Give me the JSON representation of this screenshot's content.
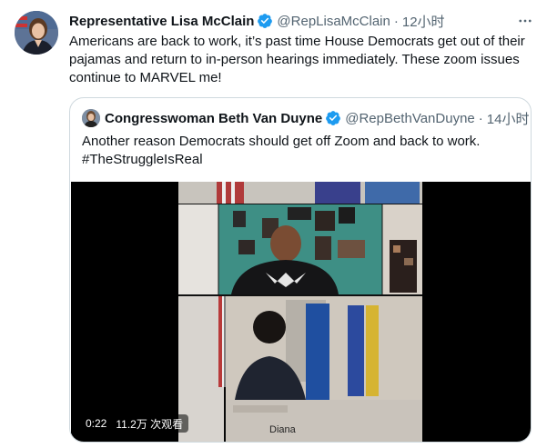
{
  "tweet": {
    "author_name": "Representative Lisa McClain",
    "author_handle": "@RepLisaMcClain",
    "separator": "·",
    "time": "12小时",
    "more_icon": "more-horizontal-icon",
    "text": "Americans are back to work, it’s past time House Democrats get out of their pajamas and return to in-person hearings immediately. These zoom issues continue to MARVEL me!"
  },
  "quote": {
    "author_name": "Congresswoman Beth Van Duyne",
    "author_handle": "@RepBethVanDuyne",
    "separator": "·",
    "time": "14小时",
    "text_line1": "Another reason Democrats should get off Zoom and back to work.",
    "text_line2": "#TheStruggleIsReal",
    "video": {
      "elapsed": "0:22",
      "views": "11.2万 次观看",
      "caption_name": "Diana"
    }
  },
  "colors": {
    "verified_badge": "#1d9bf0",
    "secondary_text": "#536471",
    "border": "#cfd9de"
  }
}
